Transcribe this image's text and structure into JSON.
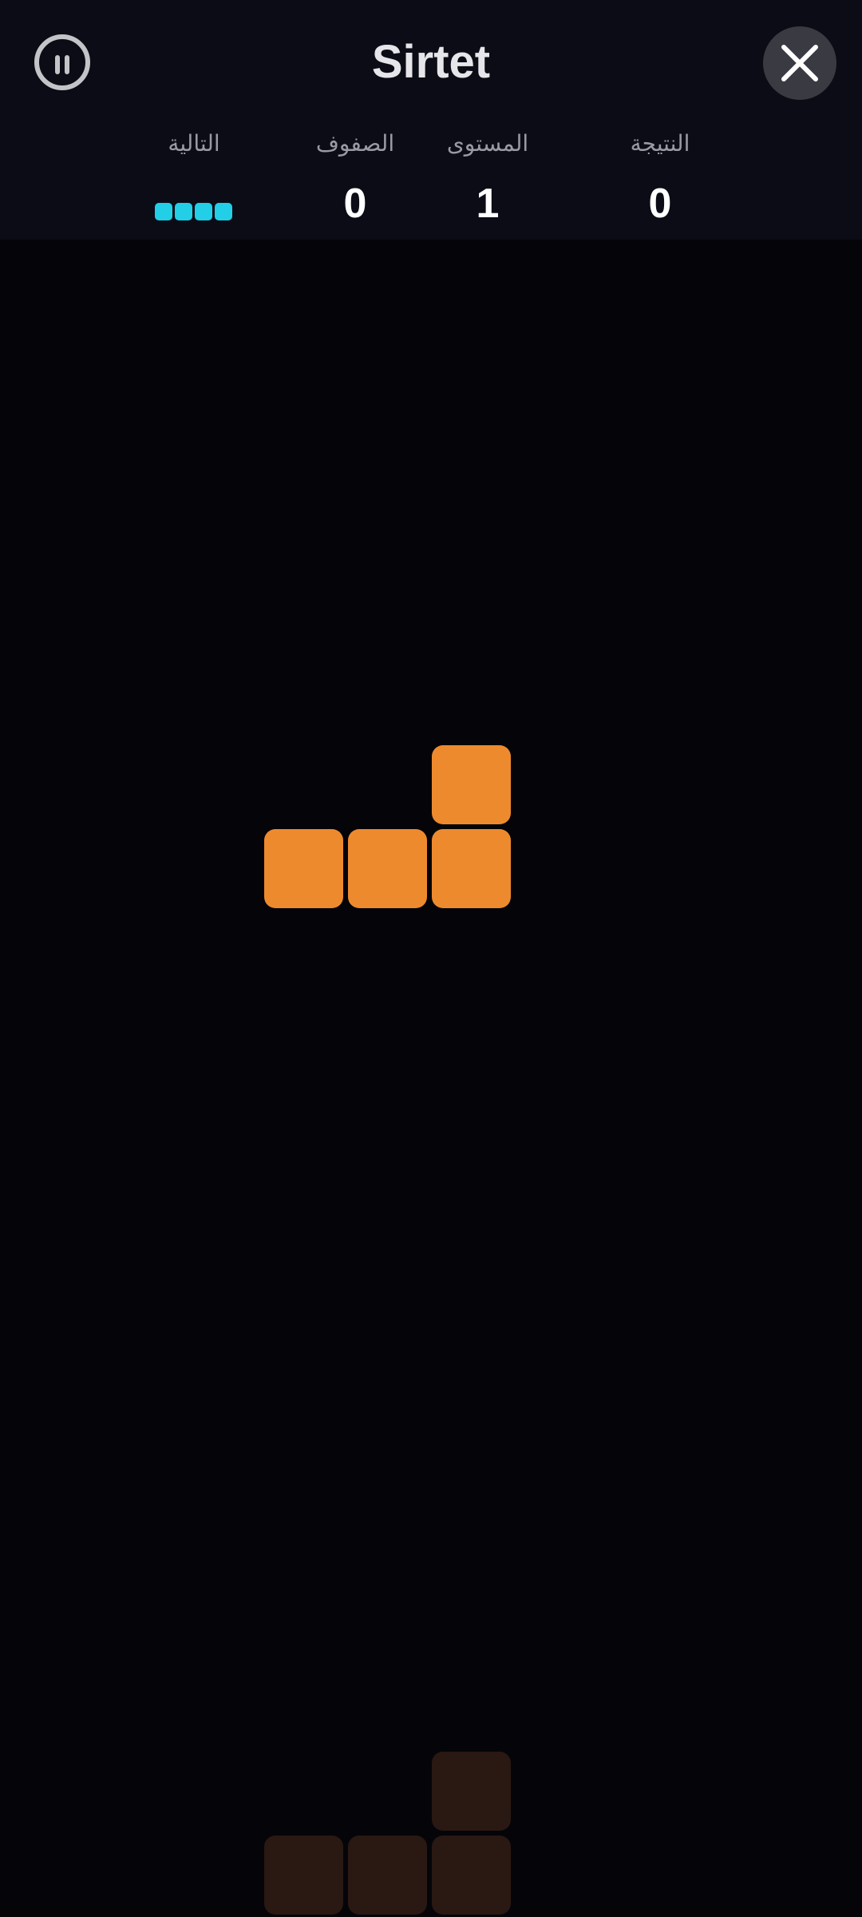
{
  "header": {
    "title": "Sirtet",
    "stats": {
      "next_label": "التالية",
      "lines_label": "الصفوف",
      "lines_value": "0",
      "level_label": "المستوى",
      "level_value": "1",
      "score_label": "النتيجة",
      "score_value": "0"
    },
    "pause_icon": "pause-circle-icon",
    "close_icon": "close-x-icon"
  },
  "next_piece": {
    "type": "I",
    "color": "#22cfe6",
    "cells": 4
  },
  "board": {
    "background": "#050509",
    "active_piece": {
      "type": "L",
      "color": "#ee8a2e",
      "cells": [
        [
          5,
          6
        ],
        [
          3,
          7
        ],
        [
          4,
          7
        ],
        [
          5,
          7
        ]
      ]
    },
    "ghost_piece": {
      "color": "#2a1813",
      "cells": [
        [
          5,
          18
        ],
        [
          3,
          19
        ],
        [
          4,
          19
        ],
        [
          5,
          19
        ]
      ]
    }
  }
}
